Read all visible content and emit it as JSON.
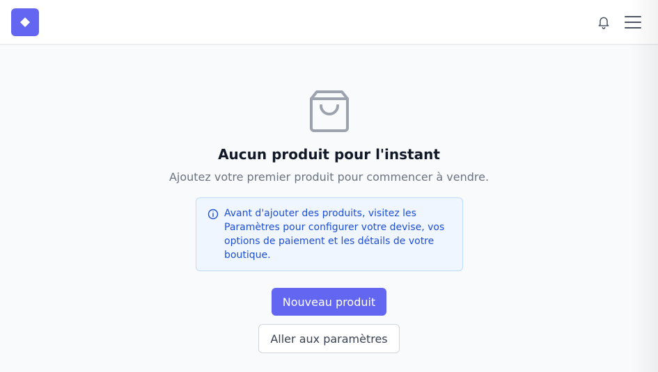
{
  "header": {
    "logo_icon": "diamond-icon",
    "notifications_icon": "bell-icon",
    "menu_icon": "hamburger-menu-icon"
  },
  "empty_state": {
    "icon": "shopping-bag-icon",
    "title": "Aucun produit pour l'instant",
    "subtitle": "Ajoutez votre premier produit pour commencer à vendre.",
    "info_icon": "info-circle-icon",
    "info_text": "Avant d'ajouter des produits, visitez les Paramètres pour configurer votre devise, vos options de paiement et les détails de votre boutique.",
    "primary_button_label": "Nouveau produit",
    "secondary_button_label": "Aller aux paramètres"
  },
  "colors": {
    "accent": "#6366f1",
    "info_bg": "#eff6ff",
    "info_border": "#bfdbfe",
    "info_text": "#1d4ed8",
    "icon_gray": "#9ca3af"
  }
}
